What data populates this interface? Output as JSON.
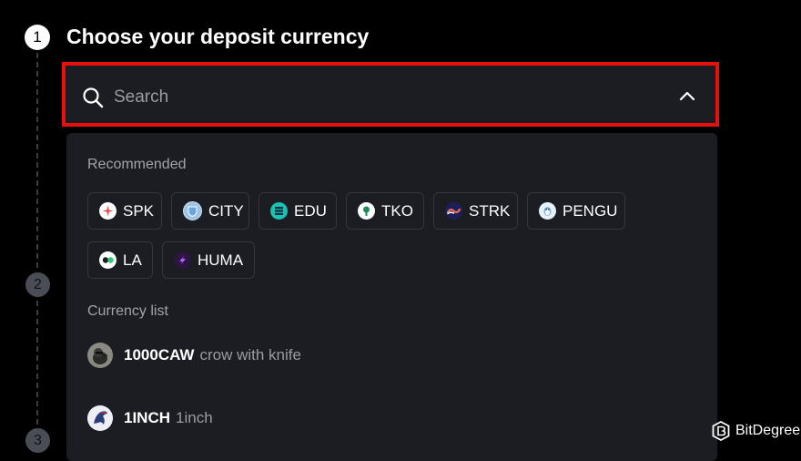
{
  "steps": {
    "step1": "1",
    "step2": "2",
    "step3": "3",
    "title": "Choose your deposit currency"
  },
  "search": {
    "placeholder": "Search",
    "highlight_color": "#e80f0f"
  },
  "dropdown": {
    "recommended_label": "Recommended",
    "recommended": [
      {
        "symbol": "SPK",
        "icon": "spk-coin-icon"
      },
      {
        "symbol": "CITY",
        "icon": "city-coin-icon"
      },
      {
        "symbol": "EDU",
        "icon": "edu-coin-icon"
      },
      {
        "symbol": "TKO",
        "icon": "tko-coin-icon"
      },
      {
        "symbol": "STRK",
        "icon": "strk-coin-icon"
      },
      {
        "symbol": "PENGU",
        "icon": "pengu-coin-icon"
      },
      {
        "symbol": "LA",
        "icon": "la-coin-icon"
      },
      {
        "symbol": "HUMA",
        "icon": "huma-coin-icon"
      }
    ],
    "currency_list_label": "Currency list",
    "currencies": [
      {
        "symbol": "1000CAW",
        "name": "crow with knife",
        "icon": "crow-coin-icon"
      },
      {
        "symbol": "1INCH",
        "name": "1inch",
        "icon": "1inch-coin-icon"
      }
    ]
  },
  "watermark": {
    "text": "BitDegree"
  }
}
